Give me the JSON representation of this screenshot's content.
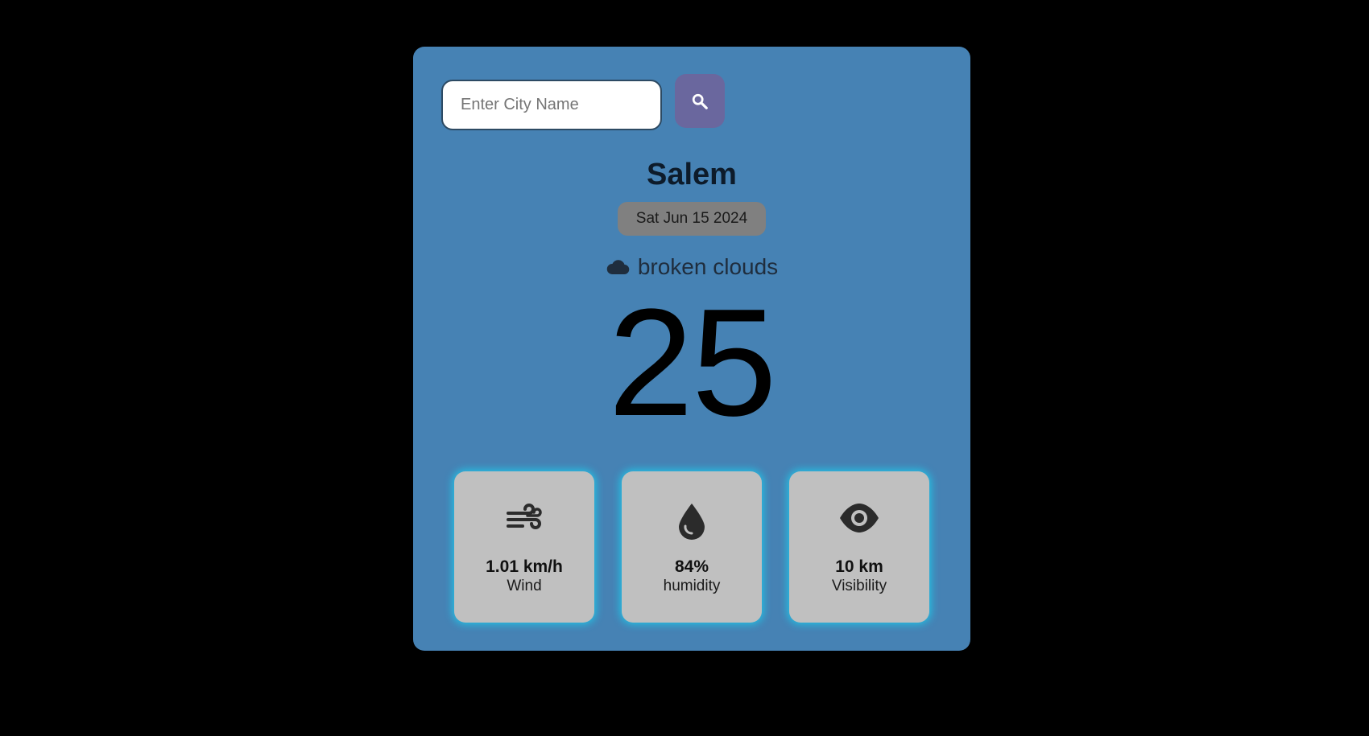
{
  "search": {
    "placeholder": "Enter City Name",
    "value": ""
  },
  "weather": {
    "city": "Salem",
    "date": "Sat Jun 15 2024",
    "condition": "broken clouds",
    "temperature": "25"
  },
  "stats": [
    {
      "icon": "wind-icon",
      "value": "1.01 km/h",
      "label": "Wind"
    },
    {
      "icon": "droplet-icon",
      "value": "84%",
      "label": "humidity"
    },
    {
      "icon": "eye-icon",
      "value": "10 km",
      "label": "Visibility"
    }
  ],
  "colors": {
    "page_background": "#000000",
    "card_background": "#4682b4",
    "search_button": "#6a679e",
    "date_badge": "#808080",
    "stat_card": "#c0c0c0",
    "stat_glow": "#21c4e6"
  }
}
